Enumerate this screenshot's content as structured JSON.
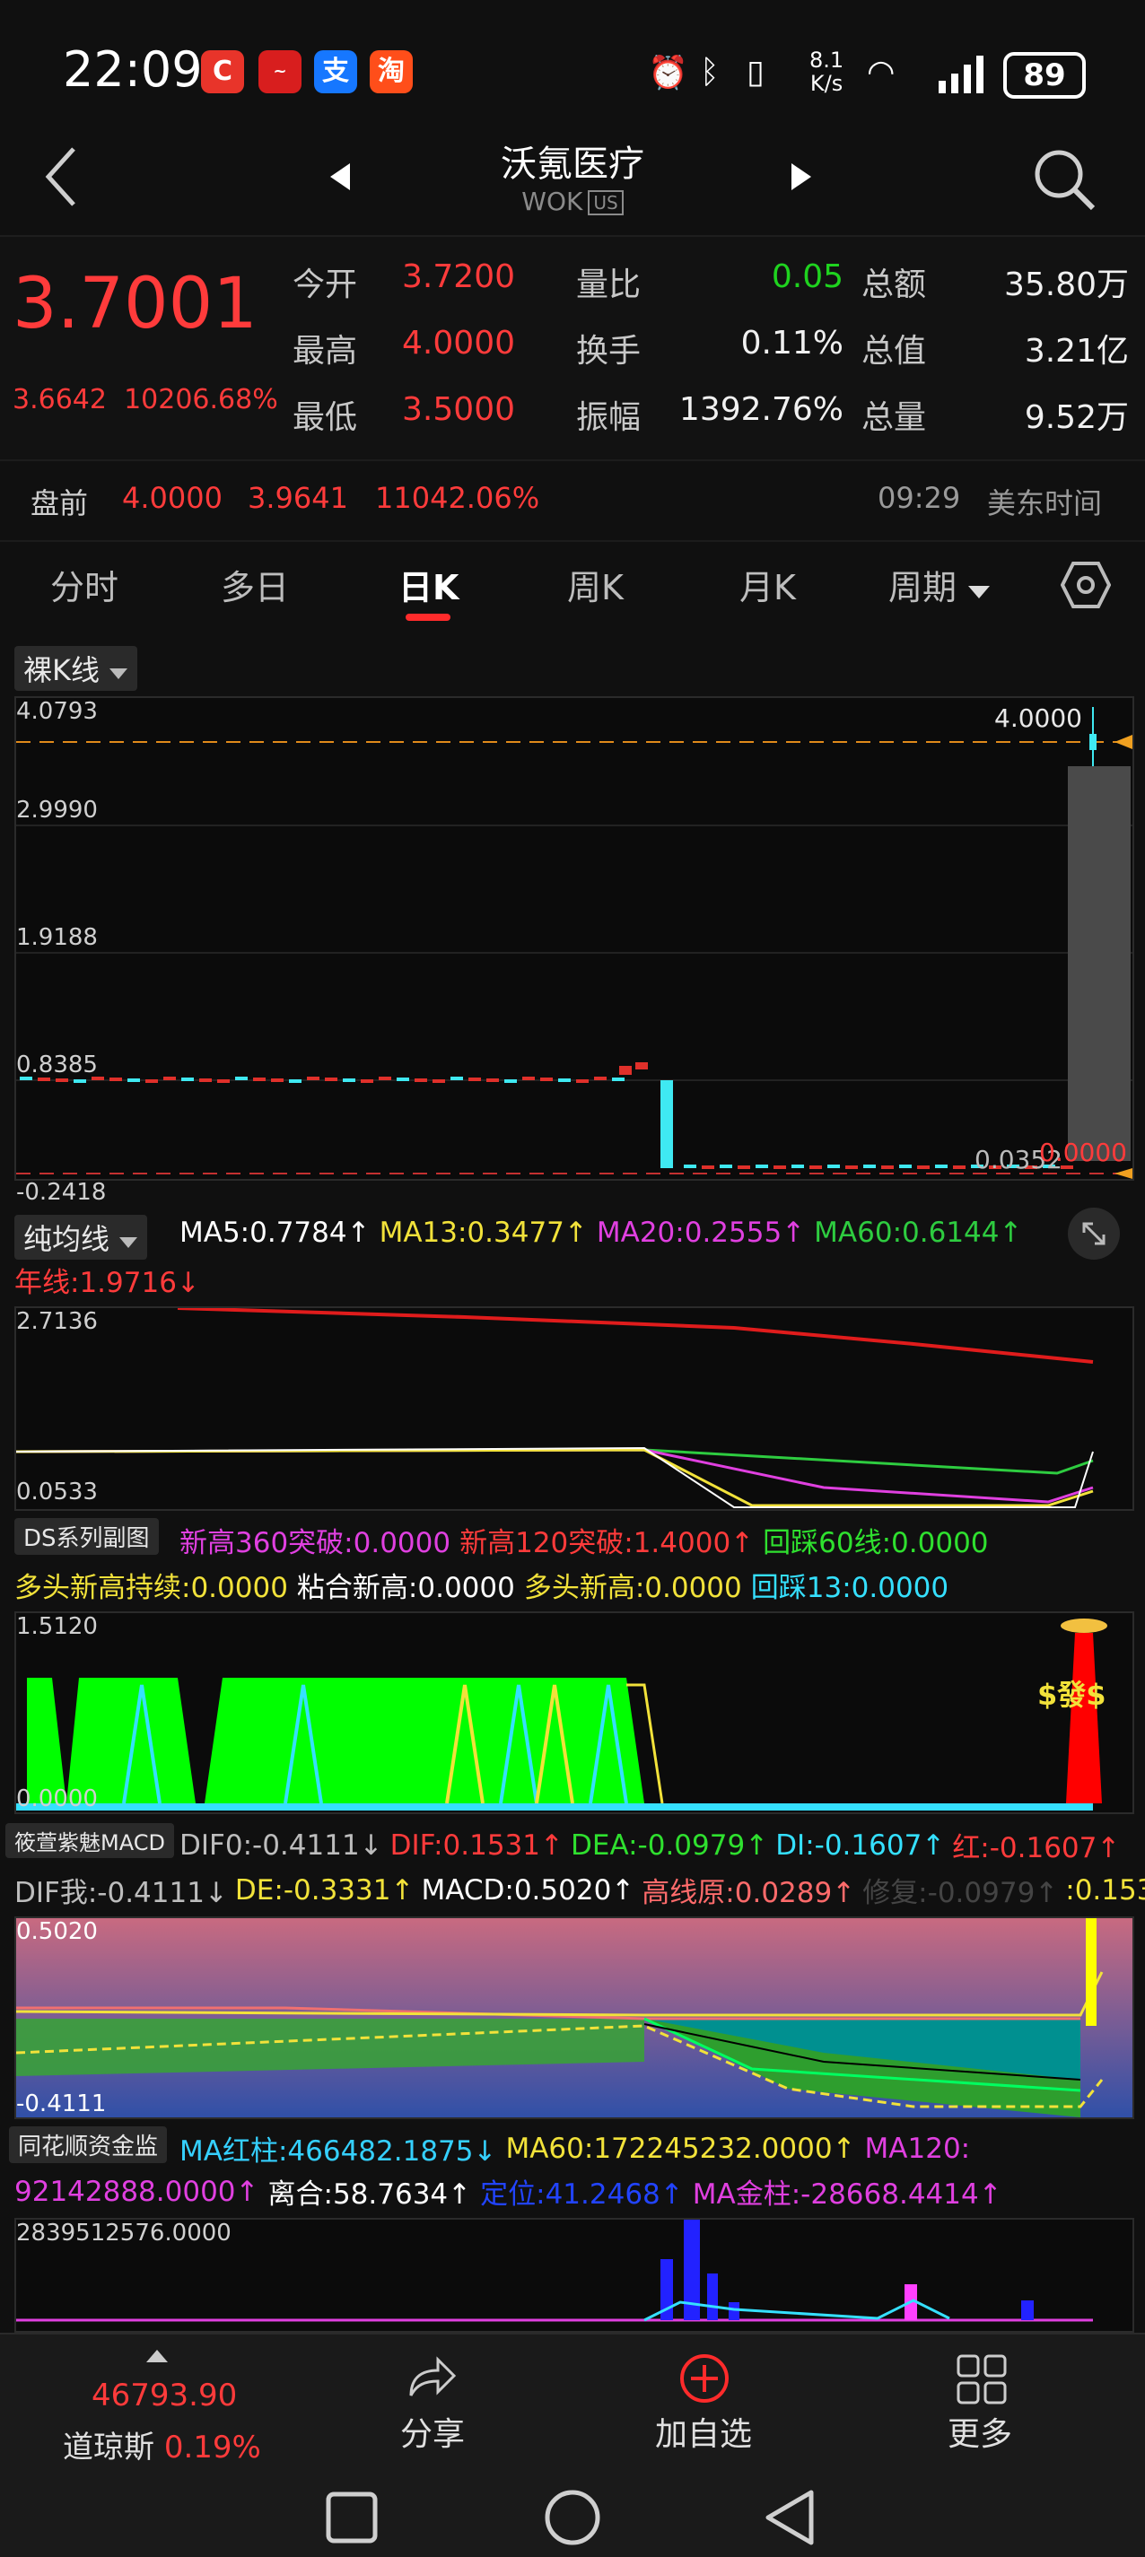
{
  "status_bar": {
    "time": "22:09",
    "net_speed_top": "8.1",
    "net_speed_bottom": "K/s",
    "battery": "89"
  },
  "header": {
    "title": "沃氪医疗",
    "ticker": "WOK",
    "market_badge": "US"
  },
  "quote": {
    "price": "3.7001",
    "change": "3.6642",
    "change_pct": "10206.68%",
    "rows": [
      [
        {
          "label": "今开",
          "value": "3.7200",
          "cls": "red"
        },
        {
          "label": "量比",
          "value": "0.05",
          "cls": "green"
        },
        {
          "label": "总额",
          "value": "35.80万",
          "cls": "white"
        }
      ],
      [
        {
          "label": "最高",
          "value": "4.0000",
          "cls": "red"
        },
        {
          "label": "换手",
          "value": "0.11%",
          "cls": "white"
        },
        {
          "label": "总值",
          "value": "3.21亿",
          "cls": "white"
        }
      ],
      [
        {
          "label": "最低",
          "value": "3.5000",
          "cls": "red"
        },
        {
          "label": "振幅",
          "value": "1392.76%",
          "cls": "white"
        },
        {
          "label": "总量",
          "value": "9.52万",
          "cls": "white"
        }
      ]
    ]
  },
  "premarket": {
    "label": "盘前",
    "price": "4.0000",
    "change": "3.9641",
    "change_pct": "11042.06%",
    "time": "09:29",
    "timezone": "美东时间"
  },
  "tabs": [
    "分时",
    "多日",
    "日K",
    "周K",
    "月K",
    "周期"
  ],
  "kline": {
    "mode": "裸K线",
    "y_labels": [
      "4.0793",
      "2.9990",
      "1.9188",
      "0.8385",
      "-0.2418"
    ],
    "last_price_label": "4.0000",
    "low_label_1": "0.0352",
    "low_label_2": "0.0000"
  },
  "ma": {
    "mode": "纯均线",
    "items": [
      {
        "text": "MA5:0.7784↑",
        "color": "#ffffff"
      },
      {
        "text": "MA13:0.3477↑",
        "color": "#f2e23a"
      },
      {
        "text": "MA20:0.2555↑",
        "color": "#e040e0"
      },
      {
        "text": "MA60:0.6144↑",
        "color": "#2ecc40"
      }
    ],
    "year_line": "年线:1.9716↓",
    "y_labels": [
      "2.7136",
      "0.0533"
    ]
  },
  "ds": {
    "mode": "DS系列副图",
    "line1": [
      {
        "text": "新高360突破:0.0000",
        "color": "#e040e0"
      },
      {
        "text": "新高120突破:1.4000↑",
        "color": "#ff3b3b"
      },
      {
        "text": "回踩60线:0.0000",
        "color": "#2fe02f"
      }
    ],
    "line2": [
      {
        "text": "多头新高持续:0.0000",
        "color": "#f2e23a"
      },
      {
        "text": "粘合新高:0.0000",
        "color": "#ffffff"
      },
      {
        "text": "多头新高:0.0000",
        "color": "#f2e23a"
      },
      {
        "text": "回踩13:0.0000",
        "color": "#35e0ff"
      }
    ],
    "y_top": "1.5120",
    "y_bottom": "0.0000",
    "signal": "$發$"
  },
  "macd": {
    "mode": "筱萱紫魅MACD",
    "line1": [
      {
        "text": "DIF0:-0.4111↓",
        "color": "#bdbdbd"
      },
      {
        "text": "DIF:0.1531↑",
        "color": "#ff3b3b"
      },
      {
        "text": "DEA:-0.0979↑",
        "color": "#2fe02f"
      },
      {
        "text": "DI:-0.1607↑",
        "color": "#35e0ff"
      },
      {
        "text": "红:-0.1607↑",
        "color": "#ff3b3b"
      }
    ],
    "line2": [
      {
        "text": "DIF我:-0.4111↓",
        "color": "#bdbdbd"
      },
      {
        "text": "DE:-0.3331↑",
        "color": "#f2e23a"
      },
      {
        "text": "MACD:0.5020↑",
        "color": "#ffffff"
      },
      {
        "text": "高线原:0.0289↑",
        "color": "#ff6b6b"
      },
      {
        "text": "修复:-0.0979↑",
        "color": "#444444"
      },
      {
        "text": ":0.153",
        "color": "#f2e23a"
      }
    ],
    "y_top": "0.5020",
    "y_bottom": "-0.4111"
  },
  "fund": {
    "mode": "同花顺资金监",
    "line1": [
      {
        "text": "MA红柱:466482.1875↓",
        "color": "#35d0ff"
      },
      {
        "text": "MA60:172245232.0000↑",
        "color": "#f2e23a"
      },
      {
        "text": "MA120:",
        "color": "#e040e0"
      }
    ],
    "line2": [
      {
        "text": "92142888.0000↑",
        "color": "#e040e0"
      },
      {
        "text": "离合:58.7634↑",
        "color": "#ffffff"
      },
      {
        "text": "定位:41.2468↑",
        "color": "#2244ff"
      },
      {
        "text": "MA金柱:-28668.4414↑",
        "color": "#e040e0"
      }
    ],
    "y_top": "2839512576.0000"
  },
  "bottom_nav": {
    "index_value": "46793.90",
    "index_name": "道琼斯",
    "index_pct": "0.19%",
    "share": "分享",
    "add_watch": "加自选",
    "more": "更多"
  }
}
